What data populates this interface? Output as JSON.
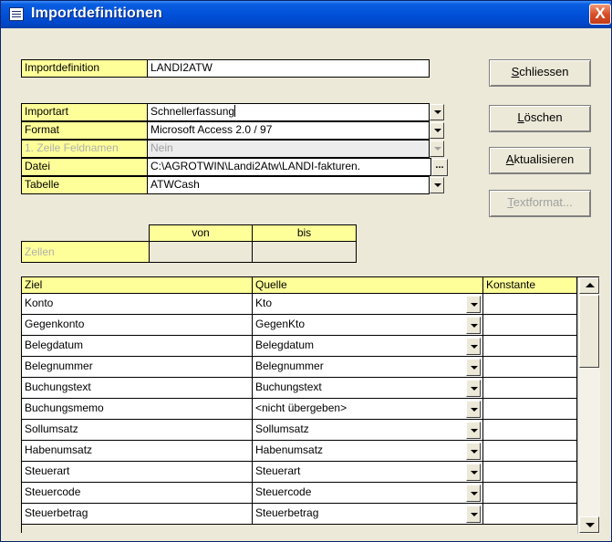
{
  "window": {
    "title": "Importdefinitionen",
    "close_label": "X"
  },
  "form": {
    "importdefinition": {
      "label": "Importdefinition",
      "value": "LANDI2ATW"
    },
    "importart": {
      "label": "Importart",
      "value": "Schnellerfassung"
    },
    "format": {
      "label": "Format",
      "value": "Microsoft Access 2.0 / 97"
    },
    "erste_zeile": {
      "label": "1. Zeile Feldnamen",
      "value": "Nein"
    },
    "datei": {
      "label": "Datei",
      "value": "C:\\AGROTWIN\\Landi2Atw\\LANDI-fakturen.",
      "browse_label": "..."
    },
    "tabelle": {
      "label": "Tabelle",
      "value": "ATWCash"
    }
  },
  "buttons": {
    "schliessen": {
      "accel": "S",
      "rest": "chliessen"
    },
    "loeschen": {
      "accel": "L",
      "rest": "öschen"
    },
    "aktualisieren": {
      "accel": "A",
      "rest": "ktualisieren"
    },
    "textformat": {
      "accel": "T",
      "rest": "extformat..."
    }
  },
  "zellen": {
    "von_label": "von",
    "bis_label": "bis",
    "row_label": "Zellen"
  },
  "mapping": {
    "headers": {
      "ziel": "Ziel",
      "quelle": "Quelle",
      "konstante": "Konstante"
    },
    "rows": [
      {
        "ziel": "Konto",
        "quelle": "Kto",
        "konstante": ""
      },
      {
        "ziel": "Gegenkonto",
        "quelle": "GegenKto",
        "konstante": ""
      },
      {
        "ziel": "Belegdatum",
        "quelle": "Belegdatum",
        "konstante": ""
      },
      {
        "ziel": "Belegnummer",
        "quelle": "Belegnummer",
        "konstante": ""
      },
      {
        "ziel": "Buchungstext",
        "quelle": "Buchungstext",
        "konstante": ""
      },
      {
        "ziel": "Buchungsmemo",
        "quelle": "<nicht übergeben>",
        "konstante": ""
      },
      {
        "ziel": "Sollumsatz",
        "quelle": "Sollumsatz",
        "konstante": ""
      },
      {
        "ziel": "Habenumsatz",
        "quelle": "Habenumsatz",
        "konstante": ""
      },
      {
        "ziel": "Steuerart",
        "quelle": "Steuerart",
        "konstante": ""
      },
      {
        "ziel": "Steuercode",
        "quelle": "Steuercode",
        "konstante": ""
      },
      {
        "ziel": "Steuerbetrag",
        "quelle": "Steuerbetrag",
        "konstante": ""
      }
    ]
  },
  "colors": {
    "label_bg": "#ffff99",
    "titlebar": "#0050d8",
    "window_bg": "#ece9d8"
  }
}
